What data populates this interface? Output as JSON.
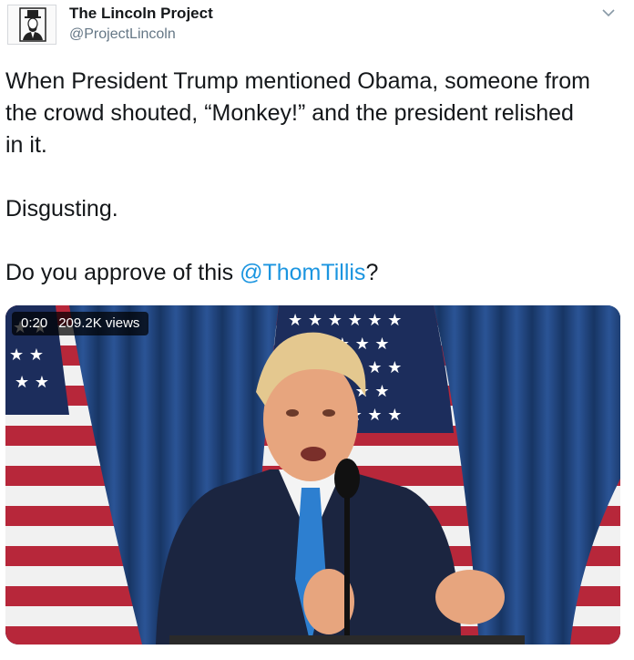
{
  "account": {
    "name": "The Lincoln Project",
    "handle": "@ProjectLincoln",
    "avatar_icon": "lincoln-portrait-icon"
  },
  "menu_icon": "chevron-down-icon",
  "tweet": {
    "line1": "When President Trump mentioned Obama, someone from",
    "line2": "the crowd shouted, “Monkey!” and the president relished",
    "line3": "in it.",
    "para2": "Disgusting.",
    "para3_prefix": "Do you approve of this ",
    "mention": "@ThomTillis",
    "para3_suffix": "?"
  },
  "video": {
    "duration": "0:20",
    "views": "209.2K views"
  },
  "colors": {
    "text": "#14171a",
    "secondary": "#657786",
    "link": "#1b95e0"
  }
}
